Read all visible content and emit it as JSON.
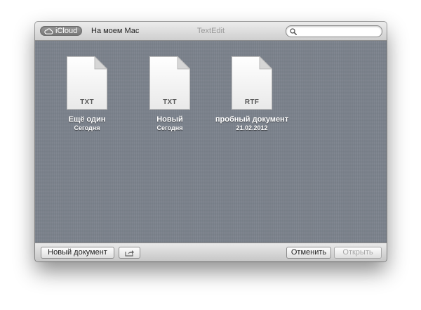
{
  "titlebar": {
    "icloud_label": "iCloud",
    "local_label": "На моем Mac",
    "app_title": "TextEdit",
    "search": {
      "value": "",
      "placeholder": ""
    }
  },
  "documents": [
    {
      "type": "TXT",
      "name": "Ещё один",
      "date": "Сегодня"
    },
    {
      "type": "TXT",
      "name": "Новый",
      "date": "Сегодня"
    },
    {
      "type": "RTF",
      "name": "пробный документ",
      "date": "21.02.2012"
    }
  ],
  "bottombar": {
    "new_document_label": "Новый документ",
    "cancel_label": "Отменить",
    "open_label": "Открыть"
  },
  "icons": {
    "icloud": "cloud-icon",
    "search": "search-icon",
    "share": "share-arrow-icon",
    "document": "document-icon"
  },
  "colors": {
    "background": "#7c838d",
    "toolbar": "#d9d9d9",
    "label_text": "#ffffff",
    "disabled_text": "#a7a7a7"
  }
}
